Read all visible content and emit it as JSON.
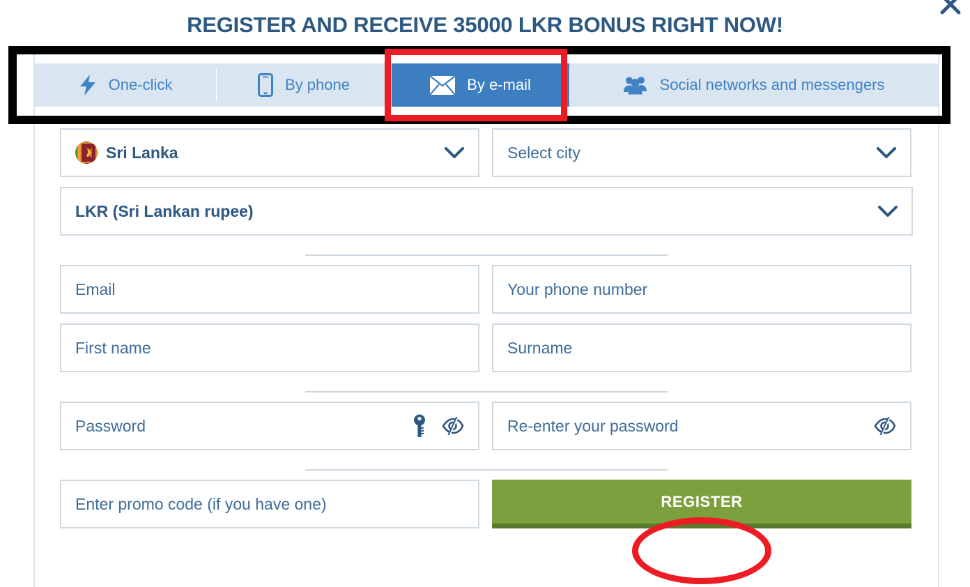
{
  "modal": {
    "title": "REGISTER AND RECEIVE 35000 LKR BONUS RIGHT NOW!",
    "close_label": "×"
  },
  "tabs": [
    {
      "id": "one-click",
      "label": "One-click",
      "icon": "lightning-bolt-icon",
      "active": false
    },
    {
      "id": "by-phone",
      "label": "By phone",
      "icon": "mobile-phone-icon",
      "active": false
    },
    {
      "id": "by-email",
      "label": "By e-mail",
      "icon": "envelope-icon",
      "active": true
    },
    {
      "id": "social",
      "label": "Social networks and messengers",
      "icon": "people-group-icon",
      "active": false
    }
  ],
  "form": {
    "country": {
      "value": "Sri Lanka",
      "flag": "sri-lanka-flag-icon"
    },
    "city": {
      "placeholder": "Select city",
      "value": "Select city"
    },
    "currency": {
      "value": "LKR (Sri Lankan rupee)"
    },
    "email": {
      "placeholder": "Email",
      "value": ""
    },
    "phone": {
      "placeholder": "Your phone number",
      "value": ""
    },
    "first_name": {
      "placeholder": "First name",
      "value": ""
    },
    "surname": {
      "placeholder": "Surname",
      "value": ""
    },
    "password": {
      "placeholder": "Password",
      "value": ""
    },
    "password_repeat": {
      "placeholder": "Re-enter your password",
      "value": ""
    },
    "promo": {
      "placeholder": "Enter promo code (if you have one)",
      "value": ""
    },
    "submit_label": "REGISTER"
  },
  "colors": {
    "title": "#2d5882",
    "tab_bar_bg": "#d9e5f0",
    "tab_active_bg": "#3c7ebf",
    "tab_text": "#3f83c4",
    "field_border": "#cfd9e2",
    "field_text": "#2d5882",
    "register_green": "#7ba03d",
    "register_green_dark": "#5b7a2b",
    "annotation_red": "#ed1c24",
    "annotation_black": "#000000"
  }
}
